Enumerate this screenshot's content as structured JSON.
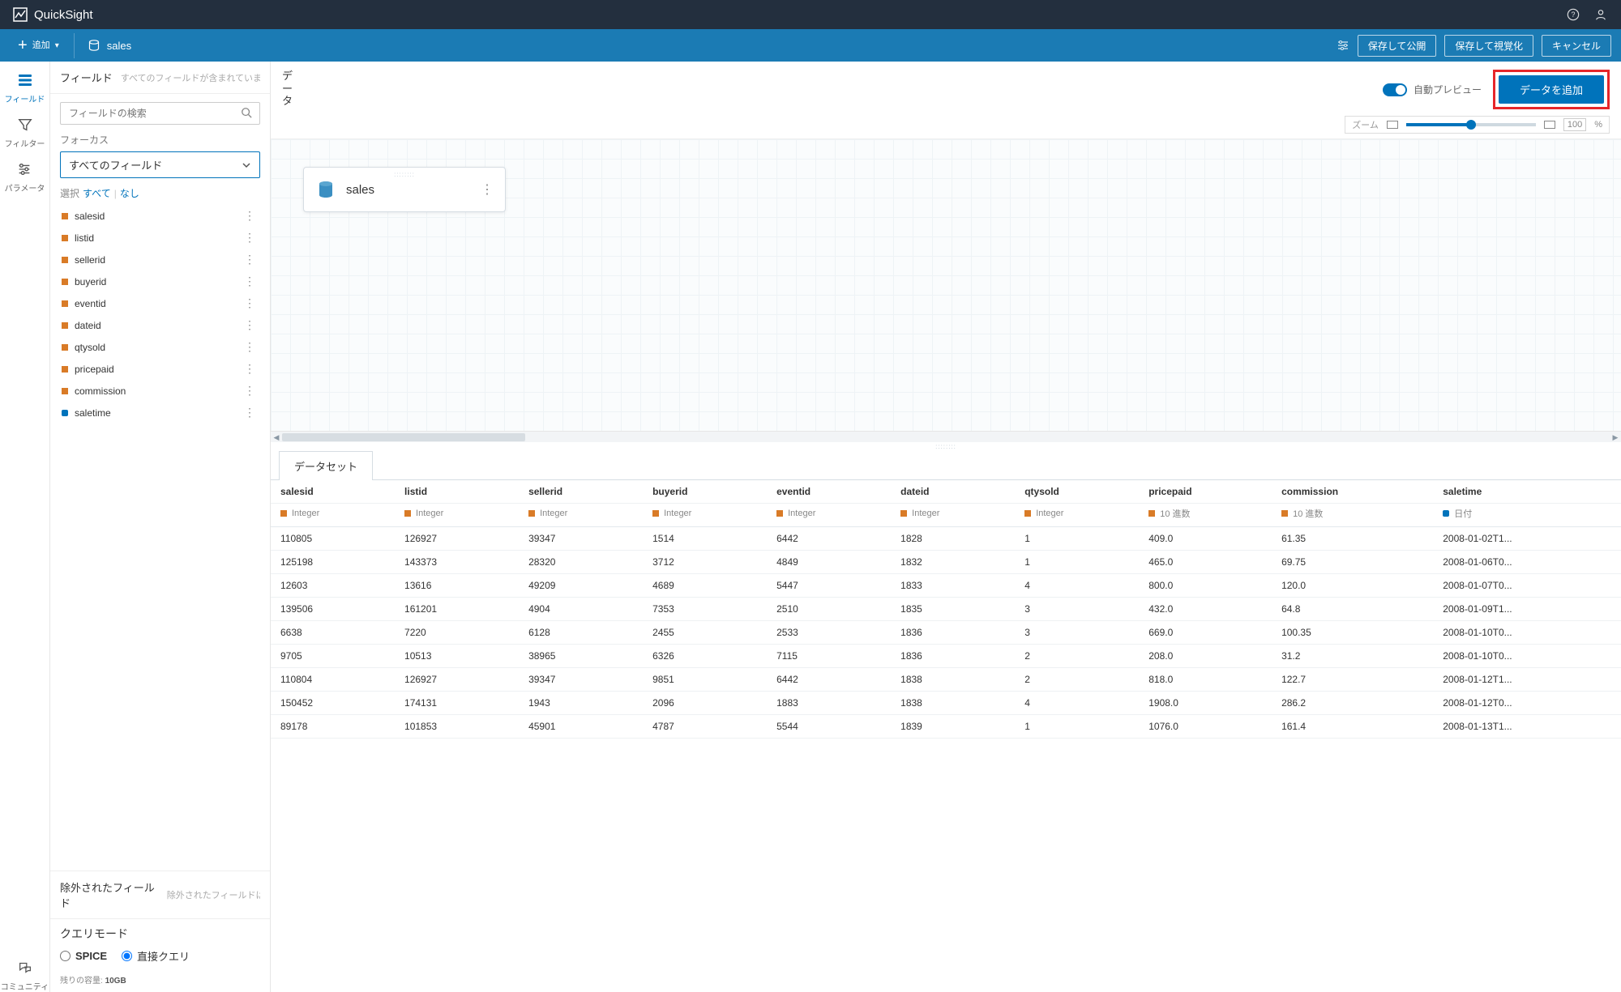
{
  "app": {
    "title": "QuickSight"
  },
  "toolbar": {
    "add_label": "追加",
    "dataset_name": "sales",
    "save_publish": "保存して公開",
    "save_visualize": "保存して視覚化",
    "cancel": "キャンセル"
  },
  "iconrail": {
    "fields": "フィールド",
    "filter": "フィルター",
    "parameters": "パラメータ",
    "community": "コミュニティ"
  },
  "fieldpanel": {
    "title": "フィールド",
    "subtitle": "すべてのフィールドが含まれています",
    "search_placeholder": "フィールドの検索",
    "focus_label": "フォーカス",
    "focus_value": "すべてのフィールド",
    "select_label": "選択",
    "select_all": "すべて",
    "select_none": "なし",
    "excluded_title": "除外されたフィールド",
    "excluded_sub": "除外されたフィールドは"
  },
  "fields": [
    {
      "name": "salesid",
      "type": "hash"
    },
    {
      "name": "listid",
      "type": "hash"
    },
    {
      "name": "sellerid",
      "type": "hash"
    },
    {
      "name": "buyerid",
      "type": "hash"
    },
    {
      "name": "eventid",
      "type": "hash"
    },
    {
      "name": "dateid",
      "type": "hash"
    },
    {
      "name": "qtysold",
      "type": "hash"
    },
    {
      "name": "pricepaid",
      "type": "hash"
    },
    {
      "name": "commission",
      "type": "hash"
    },
    {
      "name": "saletime",
      "type": "cal"
    }
  ],
  "query_mode": {
    "title": "クエリモード",
    "spice": "SPICE",
    "direct": "直接クエリ",
    "selected": "direct"
  },
  "capacity": {
    "label": "残りの容量:",
    "value": "10GB"
  },
  "canvas": {
    "data_label": "データ",
    "auto_preview": "自動プレビュー",
    "add_data": "データを追加",
    "zoom_label": "ズーム",
    "zoom_value": "100",
    "zoom_pct": "%",
    "node_name": "sales"
  },
  "tabs": {
    "dataset": "データセット"
  },
  "columns": [
    {
      "name": "salesid",
      "type": "Integer",
      "icon": "hash"
    },
    {
      "name": "listid",
      "type": "Integer",
      "icon": "hash"
    },
    {
      "name": "sellerid",
      "type": "Integer",
      "icon": "hash"
    },
    {
      "name": "buyerid",
      "type": "Integer",
      "icon": "hash"
    },
    {
      "name": "eventid",
      "type": "Integer",
      "icon": "hash"
    },
    {
      "name": "dateid",
      "type": "Integer",
      "icon": "hash"
    },
    {
      "name": "qtysold",
      "type": "Integer",
      "icon": "hash"
    },
    {
      "name": "pricepaid",
      "type": "10 進数",
      "icon": "hash"
    },
    {
      "name": "commission",
      "type": "10 進数",
      "icon": "hash"
    },
    {
      "name": "saletime",
      "type": "日付",
      "icon": "cal"
    }
  ],
  "rows": [
    [
      "110805",
      "126927",
      "39347",
      "1514",
      "6442",
      "1828",
      "1",
      "409.0",
      "61.35",
      "2008-01-02T1..."
    ],
    [
      "125198",
      "143373",
      "28320",
      "3712",
      "4849",
      "1832",
      "1",
      "465.0",
      "69.75",
      "2008-01-06T0..."
    ],
    [
      "12603",
      "13616",
      "49209",
      "4689",
      "5447",
      "1833",
      "4",
      "800.0",
      "120.0",
      "2008-01-07T0..."
    ],
    [
      "139506",
      "161201",
      "4904",
      "7353",
      "2510",
      "1835",
      "3",
      "432.0",
      "64.8",
      "2008-01-09T1..."
    ],
    [
      "6638",
      "7220",
      "6128",
      "2455",
      "2533",
      "1836",
      "3",
      "669.0",
      "100.35",
      "2008-01-10T0..."
    ],
    [
      "9705",
      "10513",
      "38965",
      "6326",
      "7115",
      "1836",
      "2",
      "208.0",
      "31.2",
      "2008-01-10T0..."
    ],
    [
      "110804",
      "126927",
      "39347",
      "9851",
      "6442",
      "1838",
      "2",
      "818.0",
      "122.7",
      "2008-01-12T1..."
    ],
    [
      "150452",
      "174131",
      "1943",
      "2096",
      "1883",
      "1838",
      "4",
      "1908.0",
      "286.2",
      "2008-01-12T0..."
    ],
    [
      "89178",
      "101853",
      "45901",
      "4787",
      "5544",
      "1839",
      "1",
      "1076.0",
      "161.4",
      "2008-01-13T1..."
    ]
  ]
}
